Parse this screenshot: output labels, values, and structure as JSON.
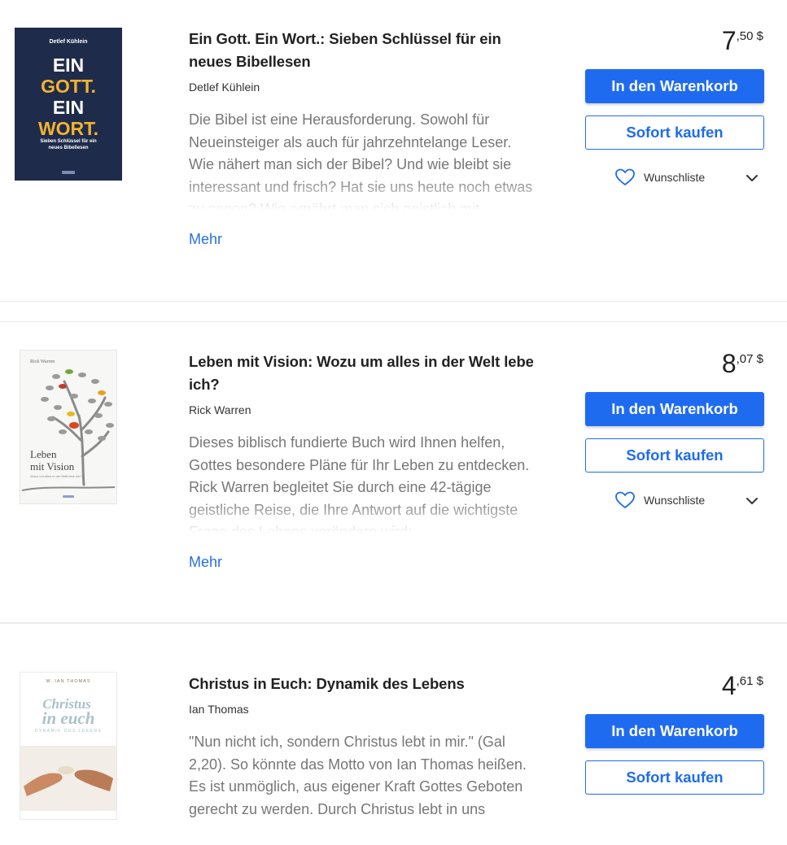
{
  "products": [
    {
      "title": "Ein Gott. Ein Wort.: Sieben Schlüssel für ein neues Bibellesen",
      "author": "Detlef Kühlein",
      "description": "Die Bibel ist eine Herausforderung. Sowohl für Neueinsteiger als auch für jahrzehntelange Leser. Wie nähert man sich der Bibel? Und wie bleibt sie interessant und frisch? Hat sie uns heute noch etwas zu sagen? Wie ernährt man sich geistlich mit",
      "more_label": "Mehr",
      "price_int": "7",
      "price_dec": ",50 $",
      "cart_label": "In den Warenkorb",
      "buy_label": "Sofort kaufen",
      "wishlist_label": "Wunschliste",
      "cover": {
        "author": "Detlef Kühlein",
        "lines": [
          "EIN",
          "GOTT.",
          "EIN",
          "WORT."
        ],
        "sub": "Sieben Schlüssel für ein neues Bibellesen"
      }
    },
    {
      "title": "Leben mit Vision: Wozu um alles in der Welt lebe ich?",
      "author": "Rick Warren",
      "description": "Dieses biblisch fundierte Buch wird Ihnen helfen, Gottes besondere Pläne für Ihr Leben zu entdecken. Rick Warren begleitet Sie durch eine 42-tägige geistliche Reise, die Ihre Antwort auf die wichtigste Frage des Lebens verändern wird:",
      "more_label": "Mehr",
      "price_int": "8",
      "price_dec": ",07 $",
      "cart_label": "In den Warenkorb",
      "buy_label": "Sofort kaufen",
      "wishlist_label": "Wunschliste",
      "cover": {
        "author": "Rick Warren",
        "line1": "Leben",
        "line2": "mit Vision",
        "sub": "Wozu um alles in der Welt lebe ich?"
      }
    },
    {
      "title": "Christus in Euch: Dynamik des Lebens",
      "author": "Ian Thomas",
      "description": "\"Nun nicht ich, sondern Christus lebt in mir.\" (Gal 2,20). So könnte das Motto von Ian Thomas heißen. Es ist unmöglich, aus eigener Kraft Gottes Geboten gerecht zu werden. Durch Christus lebt in uns",
      "price_int": "4",
      "price_dec": ",61 $",
      "cart_label": "In den Warenkorb",
      "buy_label": "Sofort kaufen",
      "cover": {
        "author": "W. IAN THOMAS",
        "line1": "Christus",
        "line2": "in euch",
        "sub": "DYNAMIK DES LEBENS"
      }
    }
  ],
  "colors": {
    "accent": "#1f6bf0",
    "link": "#2a6fe0"
  }
}
